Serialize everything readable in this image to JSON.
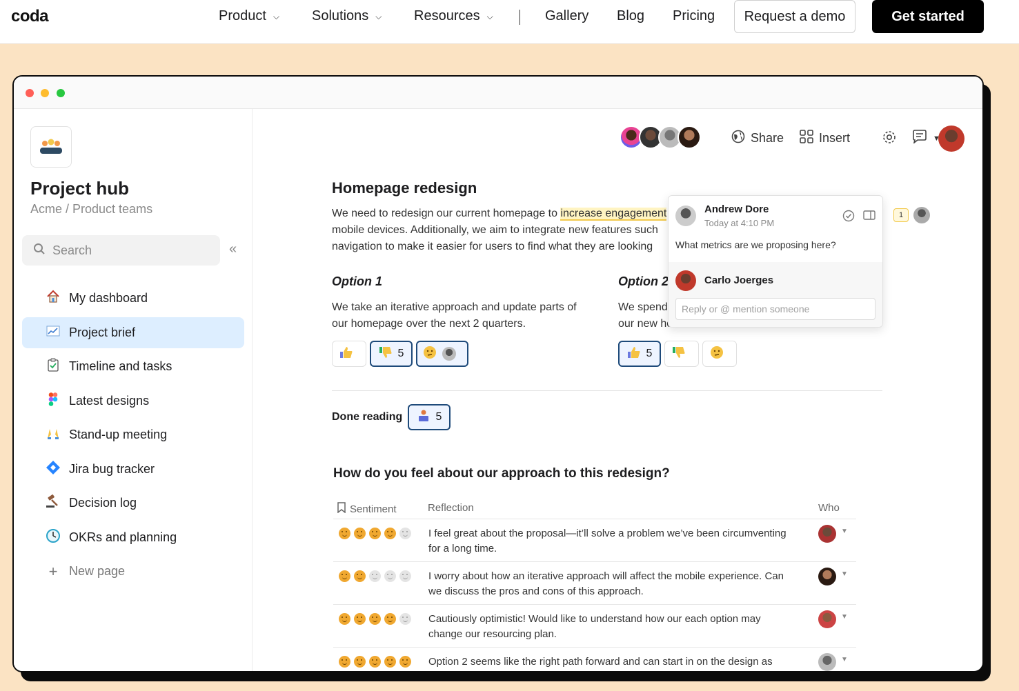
{
  "site_nav": {
    "logo": "coda",
    "items": [
      {
        "label": "Product",
        "has_menu": true
      },
      {
        "label": "Solutions",
        "has_menu": true
      },
      {
        "label": "Resources",
        "has_menu": true
      },
      {
        "label": "Gallery",
        "has_menu": false
      },
      {
        "label": "Blog",
        "has_menu": false
      },
      {
        "label": "Pricing",
        "has_menu": false
      }
    ],
    "demo_button": "Request a demo",
    "start_button": "Get started"
  },
  "sidebar": {
    "title": "Project hub",
    "breadcrumb": "Acme / Product teams",
    "search_placeholder": "Search",
    "items": [
      {
        "label": "My dashboard",
        "icon": "house-icon"
      },
      {
        "label": "Project brief",
        "icon": "chart-icon",
        "active": true
      },
      {
        "label": "Timeline and tasks",
        "icon": "clipboard-check-icon"
      },
      {
        "label": "Latest designs",
        "icon": "figma-icon"
      },
      {
        "label": "Stand-up meeting",
        "icon": "raised-hands-icon"
      },
      {
        "label": "Jira bug tracker",
        "icon": "jira-icon"
      },
      {
        "label": "Decision log",
        "icon": "gavel-icon"
      },
      {
        "label": "OKRs and planning",
        "icon": "clock-icon"
      }
    ],
    "new_page": "New page"
  },
  "toolbar": {
    "share": "Share",
    "insert": "Insert"
  },
  "doc": {
    "title": "Homepage redesign",
    "para_line1_pre": "We need to redesign our current homepage to ",
    "para_line1_hl": "increase engagement",
    "para_line2": "mobile devices. Additionally, we aim to integrate new features such",
    "para_line3": "navigation to make it easier for users to find what they are looking",
    "option1_title": "Option 1",
    "option1_line1": "We take an iterative approach and update parts of",
    "option1_line2": "our homepage over the next 2 quarters.",
    "option2_title": "Option 2",
    "option2_line1": "We spend",
    "option2_line2": "our new ho",
    "option1_reactions": [
      {
        "emoji": "thumbs-up-icon",
        "count": ""
      },
      {
        "emoji": "thumbs-down-icon",
        "count": "5"
      },
      {
        "emoji": "thinking-face-icon",
        "count": ""
      }
    ],
    "option2_reactions": [
      {
        "emoji": "thumbs-up-icon",
        "count": "5"
      },
      {
        "emoji": "thumbs-down-icon",
        "count": ""
      },
      {
        "emoji": "thinking-face-icon",
        "count": ""
      }
    ],
    "done_reading_label": "Done reading",
    "done_reading_count": "5",
    "question": "How do you feel about our approach to this redesign?"
  },
  "feedback_table": {
    "columns": [
      "Sentiment",
      "Reflection",
      "Who"
    ],
    "rows": [
      {
        "sentiment": 4,
        "line1": "I feel great about the proposal—it’ll solve a problem we’ve been circumventing",
        "line2": "for a long time."
      },
      {
        "sentiment": 2,
        "line1": "I worry about how an iterative approach will affect the mobile experience. Can",
        "line2": "we discuss the pros and cons of this approach."
      },
      {
        "sentiment": 4,
        "line1": "Cautiously optimistic! Would like to understand how our each option may",
        "line2": "change our resourcing plan."
      },
      {
        "sentiment": 5,
        "line1": "Option 2 seems like the right path forward and can start in on the design as",
        "line2": ""
      }
    ]
  },
  "comment": {
    "author": "Andrew Dore",
    "time": "Today at 4:10 PM",
    "text": "What metrics are we proposing here?",
    "replier": "Carlo Joerges",
    "reply_placeholder": "Reply or @ mention someone",
    "badge_count": "1"
  },
  "colors": {
    "page_bg": "#fbe3c3",
    "accent_blue": "#1e4a7a",
    "active_item_bg": "#ddeeff",
    "highlight": "#fff4c2",
    "sentiment_on": "#f0a830"
  }
}
